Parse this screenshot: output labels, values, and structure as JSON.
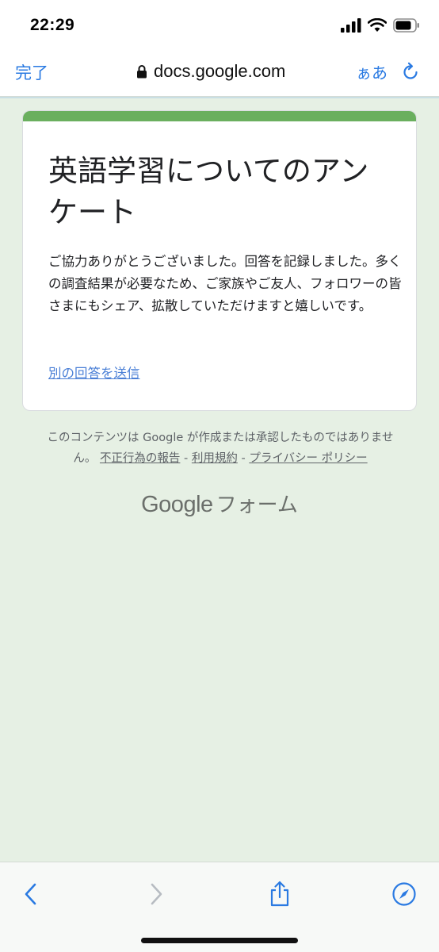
{
  "status_bar": {
    "time": "22:29"
  },
  "address_bar": {
    "done_label": "完了",
    "url": "docs.google.com",
    "text_size_label": "ぁあ"
  },
  "form": {
    "title": "英語学習についてのアンケート",
    "message": "ご協力ありがとうございました。回答を記録しました。多くの調査結果が必要なため、ご家族やご友人、フォロワーの皆さまにもシェア、拡散していただけますと嬉しいです。",
    "resubmit_link": "別の回答を送信"
  },
  "footer": {
    "disclaimer": "このコンテンツは Google が作成または承認したものではありません。",
    "report_link": "不正行為の報告",
    "separator": "-",
    "terms_link": "利用規約",
    "privacy_link": "プライバシー ポリシー",
    "brand_google": "Google",
    "brand_forms": "フォーム"
  },
  "toolbar": {
    "icons": [
      "back-icon",
      "forward-icon",
      "share-icon",
      "compass-icon"
    ]
  },
  "colors": {
    "accent": "#2a7ae2",
    "form_theme": "#6aaf5e",
    "page_background": "#e6f0e4",
    "link": "#4a7fd6"
  }
}
